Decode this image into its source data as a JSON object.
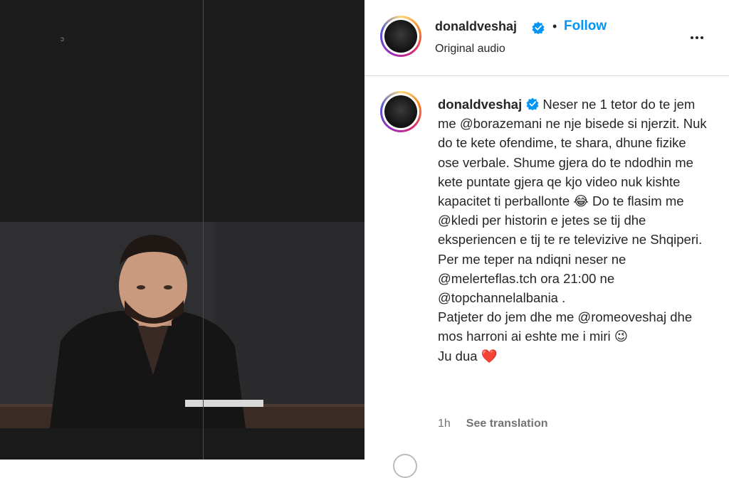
{
  "post": {
    "author": "donaldveshaj",
    "follow_label": "Follow",
    "separator": "•",
    "audio": "Original audio",
    "caption": {
      "username": "donaldveshaj",
      "parts": [
        {
          "t": "text",
          "v": " Neser ne 1 tetor do te jem me "
        },
        {
          "t": "mention",
          "v": "@borazemani"
        },
        {
          "t": "text",
          "v": " ne nje bisede si njerzit. Nuk do te kete ofendime, te shara, dhune fizike ose verbale. Shume gjera do te ndodhin me kete puntate gjera qe kjo video nuk kishte kapacitet ti perballonte "
        },
        {
          "t": "emoji",
          "v": "😂"
        },
        {
          "t": "text",
          "v": " Do te flasim me "
        },
        {
          "t": "mention",
          "v": "@kledi"
        },
        {
          "t": "text",
          "v": " per historin e jetes se tij dhe eksperiencen e tij te re televizive ne Shqiperi. Per me teper na ndiqni neser ne "
        },
        {
          "t": "mention",
          "v": "@melerteflas.tch"
        },
        {
          "t": "text",
          "v": " ora 21:00 ne "
        },
        {
          "t": "mention",
          "v": "@topchannelalbania"
        },
        {
          "t": "text",
          "v": " ."
        },
        {
          "t": "br"
        },
        {
          "t": "text",
          "v": "Patjeter do jem dhe me "
        },
        {
          "t": "mention",
          "v": "@romeoveshaj"
        },
        {
          "t": "text",
          "v": " dhe mos harroni ai eshte me i miri "
        },
        {
          "t": "emoji",
          "v": "😉"
        },
        {
          "t": "br"
        },
        {
          "t": "text",
          "v": "Ju dua "
        },
        {
          "t": "emoji",
          "v": "❤️"
        }
      ]
    },
    "time_ago": "1h",
    "see_translation": "See translation"
  },
  "video": {
    "corner_mark": "ↄ"
  },
  "icons": {
    "more": "more-options-icon",
    "verified": "verified-badge-icon"
  },
  "colors": {
    "accent": "#0095f6",
    "verified": "#0095f6",
    "text": "#262626",
    "muted": "#737373"
  }
}
